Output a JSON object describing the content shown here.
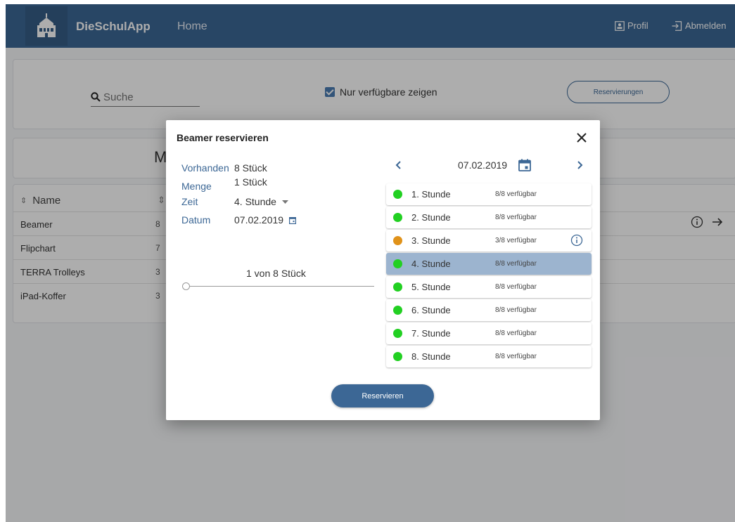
{
  "header": {
    "app_title": "DieSchulApp",
    "home_label": "Home",
    "profile_label": "Profil",
    "logout_label": "Abmelden",
    "brand_color": "#3c6795"
  },
  "filter": {
    "search_placeholder": "Suche",
    "only_available_label": "Nur verfügbare zeigen",
    "only_available_checked": true,
    "reservations_button": "Reservierungen"
  },
  "background": {
    "title_partial": "M",
    "column_name": "Name",
    "items": [
      {
        "name": "Beamer",
        "qty": "8"
      },
      {
        "name": "Flipchart",
        "qty": "7"
      },
      {
        "name": "TERRA Trolleys",
        "qty": "3"
      },
      {
        "name": "iPad-Koffer",
        "qty": "3"
      }
    ]
  },
  "dialog": {
    "title": "Beamer reservieren",
    "info": {
      "available_label": "Vorhanden",
      "available_value": "8 Stück",
      "amount_label": "Menge",
      "amount_value": "1 Stück",
      "time_label": "Zeit",
      "time_value": "4. Stunde",
      "date_label": "Datum",
      "date_value": "07.02.2019"
    },
    "slider_label": "1 von 8 Stück",
    "slider_value": 1,
    "slider_max": 8,
    "calendar_date": "07.02.2019",
    "slots": [
      {
        "name": "1. Stunde",
        "availability": "8/8 verfügbar",
        "status_color": "#22d022",
        "selected": false,
        "info": false
      },
      {
        "name": "2. Stunde",
        "availability": "8/8 verfügbar",
        "status_color": "#22d022",
        "selected": false,
        "info": false
      },
      {
        "name": "3. Stunde",
        "availability": "3/8 verfügbar",
        "status_color": "#e0921a",
        "selected": false,
        "info": true
      },
      {
        "name": "4. Stunde",
        "availability": "8/8 verfügbar",
        "status_color": "#22d022",
        "selected": true,
        "info": false
      },
      {
        "name": "5. Stunde",
        "availability": "8/8 verfügbar",
        "status_color": "#22d022",
        "selected": false,
        "info": false
      },
      {
        "name": "6. Stunde",
        "availability": "8/8 verfügbar",
        "status_color": "#22d022",
        "selected": false,
        "info": false
      },
      {
        "name": "7. Stunde",
        "availability": "8/8 verfügbar",
        "status_color": "#22d022",
        "selected": false,
        "info": false
      },
      {
        "name": "8. Stunde",
        "availability": "8/8 verfügbar",
        "status_color": "#22d022",
        "selected": false,
        "info": false
      }
    ],
    "reserve_button": "Reservieren"
  }
}
